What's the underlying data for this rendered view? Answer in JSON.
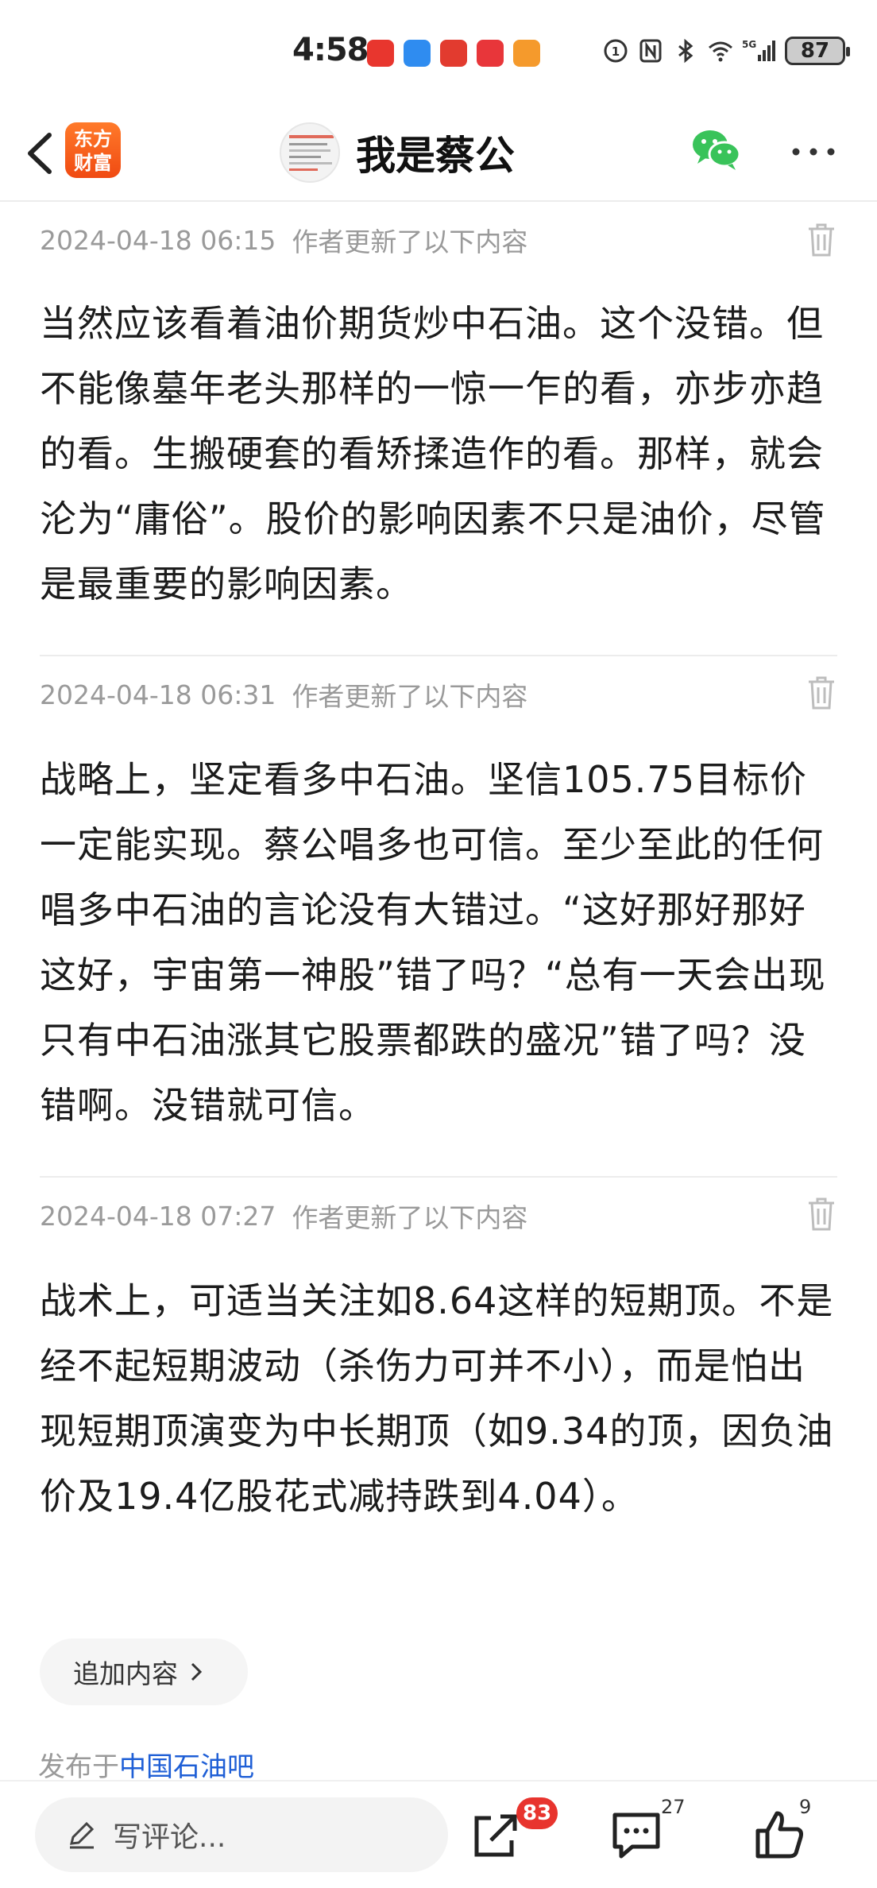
{
  "status_bar": {
    "time": "4:58",
    "battery": "87",
    "network": "5G"
  },
  "nav": {
    "app_logo_line1": "东方",
    "app_logo_line2": "财富",
    "title": "我是蔡公"
  },
  "updates": [
    {
      "timestamp": "2024-04-18 06:15",
      "note": "作者更新了以下内容",
      "text": "当然应该看着油价期货炒中石油。这个没错。但不能像墓年老头那样的一惊一乍的看，亦步亦趋的看。生搬硬套的看矫揉造作的看。那样，就会沦为“庸俗”。股价的影响因素不只是油价，尽管是最重要的影响因素。"
    },
    {
      "timestamp": "2024-04-18 06:31",
      "note": "作者更新了以下内容",
      "text": "战略上，坚定看多中石油。坚信105.75目标价一定能实现。蔡公唱多也可信。至少至此的任何唱多中石油的言论没有大错过。“这好那好那好这好，宇宙第一神股”错了吗？“总有一天会出现只有中石油涨其它股票都跌的盛况”错了吗？没错啊。没错就可信。"
    },
    {
      "timestamp": "2024-04-18 07:27",
      "note": "作者更新了以下内容",
      "text": "战术上，可适当关注如8.64这样的短期顶。不是经不起短期波动（杀伤力可并不小），而是怕出现短期顶演变为中长期顶（如9.34的顶，因负油价及19.4亿股花式减持跌到4.04）。"
    }
  ],
  "append_label": "追加内容",
  "published": {
    "prefix": "发布于",
    "bar_name": "中国石油吧"
  },
  "bottom": {
    "comment_placeholder": "写评论...",
    "share_badge": "83",
    "comment_count": "27",
    "like_count": "9"
  },
  "colors": {
    "accent_orange": "#f04a12",
    "link_blue": "#1f5fd6",
    "badge_red": "#e8342e",
    "wechat_green": "#39c35a"
  }
}
